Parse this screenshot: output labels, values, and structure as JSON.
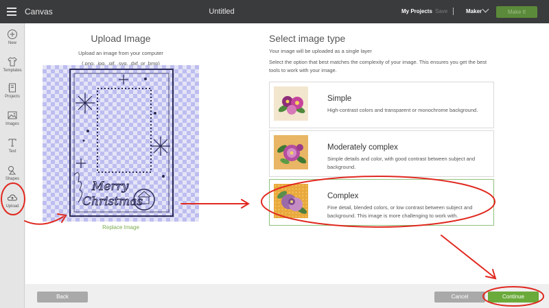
{
  "topbar": {
    "app_title": "Canvas",
    "doc_title": "Untitled",
    "my_projects": "My Projects",
    "save": "Save",
    "machine": "Maker",
    "make_it": "Make It"
  },
  "sidebar": {
    "items": [
      {
        "label": "New",
        "icon": "plus-icon"
      },
      {
        "label": "Templates",
        "icon": "shirt-icon"
      },
      {
        "label": "Projects",
        "icon": "notebook-icon"
      },
      {
        "label": "Images",
        "icon": "image-icon"
      },
      {
        "label": "Text",
        "icon": "text-icon"
      },
      {
        "label": "Shapes",
        "icon": "shapes-icon"
      },
      {
        "label": "Upload",
        "icon": "upload-cloud-icon"
      }
    ]
  },
  "upload": {
    "title": "Upload Image",
    "subtitle_line1": "Upload an image from your computer",
    "subtitle_line2": "(.png, .jpg, .gif, .svg, .dxf, or .bmp)",
    "replace": "Replace Image",
    "preview_text": "Merry Christmas"
  },
  "select": {
    "title": "Select image type",
    "sub1": "Your image will be uploaded as a single layer",
    "sub2": "Select the option that best matches the complexity of your image. This ensures you get the best tools to work with your image.",
    "options": [
      {
        "title": "Simple",
        "desc": "High-contrast colors and transparent or monochrome background.",
        "thumb_bg": "#f3e6cf"
      },
      {
        "title": "Moderately complex",
        "desc": "Simple details and color, with good contrast between subject and background.",
        "thumb_bg": "#e8b664"
      },
      {
        "title": "Complex",
        "desc": "Fine detail, blended colors, or low contrast between subject and background. This image is more challenging to work with.",
        "thumb_bg": "#e9a93c",
        "selected": true
      }
    ]
  },
  "footer": {
    "back": "Back",
    "cancel": "Cancel",
    "continue": "Continue"
  },
  "colors": {
    "topbar": "#3a3b3c",
    "accent_green": "#6aaa3a",
    "annotation_red": "#e0281f"
  }
}
